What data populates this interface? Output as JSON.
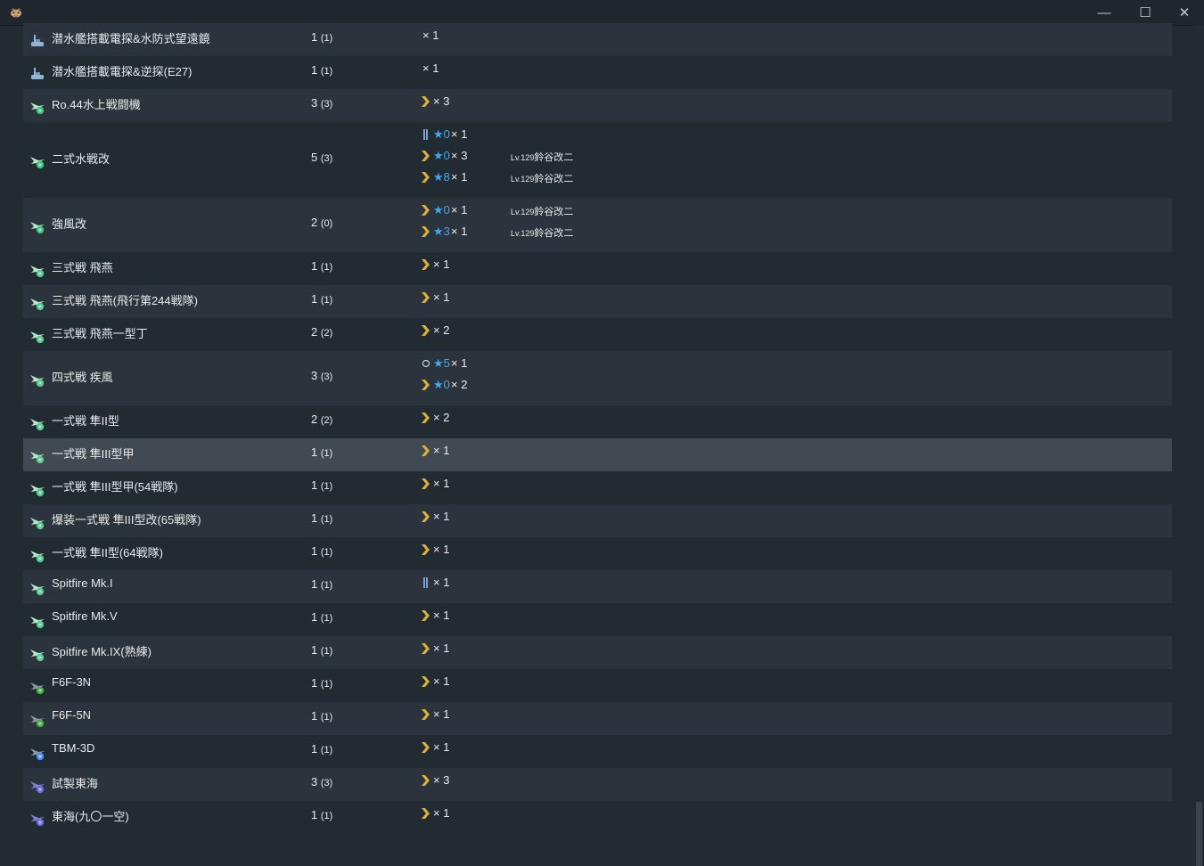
{
  "window": {
    "minimize_glyph": "—",
    "maximize_glyph": "☐",
    "close_glyph": "✕"
  },
  "colors": {
    "prof_chevron": "#d8b23a",
    "prof_bar": "#7f9fd0",
    "prof_circle": "#c9d0d6",
    "star": "#3fa8f4",
    "icon_seaplane": "#3dc080",
    "icon_fighter": "#54c890",
    "icon_nightfighter": "#4aa84a",
    "icon_torpedo": "#4a8ff0",
    "icon_lbaa": "#6a6ae0"
  },
  "rows": [
    {
      "name": "潜水艦搭載電探&水防式望遠鏡",
      "count": "1",
      "count_sub": "(1)",
      "icon": "sub-equipment-icon",
      "details": [
        {
          "prof": "none",
          "mult": "× 1"
        }
      ]
    },
    {
      "name": "潜水艦搭載電探&逆探(E27)",
      "count": "1",
      "count_sub": "(1)",
      "icon": "sub-equipment-icon",
      "details": [
        {
          "prof": "none",
          "mult": "× 1"
        }
      ]
    },
    {
      "name": "Ro.44水上戦闘機",
      "count": "3",
      "count_sub": "(3)",
      "icon": "seaplane-fighter-icon",
      "details": [
        {
          "prof": "chevron",
          "mult": "× 3"
        }
      ]
    },
    {
      "name": "二式水戦改",
      "count": "5",
      "count_sub": "(3)",
      "icon": "seaplane-fighter-icon",
      "details": [
        {
          "prof": "bar",
          "star": "★0",
          "mult": "× 1"
        },
        {
          "prof": "chevron",
          "star": "★0",
          "mult": "× 3",
          "lv_tag": "Lv.129",
          "ship": "鈴谷改二"
        },
        {
          "prof": "chevron",
          "star": "★8",
          "mult": "× 1",
          "lv_tag": "Lv.129",
          "ship": "鈴谷改二"
        }
      ]
    },
    {
      "name": "強風改",
      "count": "2",
      "count_sub": "(0)",
      "icon": "seaplane-fighter-icon",
      "details": [
        {
          "prof": "chevron",
          "star": "★0",
          "mult": "× 1",
          "lv_tag": "Lv.129",
          "ship": "鈴谷改二"
        },
        {
          "prof": "chevron",
          "star": "★3",
          "mult": "× 1",
          "lv_tag": "Lv.129",
          "ship": "鈴谷改二"
        }
      ]
    },
    {
      "name": "三式戦 飛燕",
      "count": "1",
      "count_sub": "(1)",
      "icon": "fighter-icon",
      "details": [
        {
          "prof": "chevron",
          "mult": "× 1"
        }
      ]
    },
    {
      "name": "三式戦 飛燕(飛行第244戦隊)",
      "count": "1",
      "count_sub": "(1)",
      "icon": "fighter-icon",
      "details": [
        {
          "prof": "chevron",
          "mult": "× 1"
        }
      ]
    },
    {
      "name": "三式戦 飛燕一型丁",
      "count": "2",
      "count_sub": "(2)",
      "icon": "fighter-icon",
      "details": [
        {
          "prof": "chevron",
          "mult": "× 2"
        }
      ]
    },
    {
      "name": "四式戦 疾風",
      "count": "3",
      "count_sub": "(3)",
      "icon": "fighter-icon",
      "details": [
        {
          "prof": "circle",
          "star": "★5",
          "mult": "× 1"
        },
        {
          "prof": "chevron",
          "star": "★0",
          "mult": "× 2"
        }
      ]
    },
    {
      "name": "一式戦 隼II型",
      "count": "2",
      "count_sub": "(2)",
      "icon": "fighter-icon",
      "details": [
        {
          "prof": "chevron",
          "mult": "× 2"
        }
      ]
    },
    {
      "name": "一式戦 隼III型甲",
      "count": "1",
      "count_sub": "(1)",
      "icon": "fighter-icon",
      "selected": true,
      "details": [
        {
          "prof": "chevron",
          "mult": "× 1"
        }
      ]
    },
    {
      "name": "一式戦 隼III型甲(54戦隊)",
      "count": "1",
      "count_sub": "(1)",
      "icon": "fighter-icon",
      "details": [
        {
          "prof": "chevron",
          "mult": "× 1"
        }
      ]
    },
    {
      "name": "爆装一式戦 隼III型改(65戦隊)",
      "count": "1",
      "count_sub": "(1)",
      "icon": "fighter-icon",
      "details": [
        {
          "prof": "chevron",
          "mult": "× 1"
        }
      ]
    },
    {
      "name": "一式戦 隼II型(64戦隊)",
      "count": "1",
      "count_sub": "(1)",
      "icon": "fighter-icon",
      "details": [
        {
          "prof": "chevron",
          "mult": "× 1"
        }
      ]
    },
    {
      "name": "Spitfire Mk.I",
      "count": "1",
      "count_sub": "(1)",
      "icon": "fighter-icon",
      "details": [
        {
          "prof": "bar",
          "mult": "× 1"
        }
      ]
    },
    {
      "name": "Spitfire Mk.V",
      "count": "1",
      "count_sub": "(1)",
      "icon": "fighter-icon",
      "details": [
        {
          "prof": "chevron",
          "mult": "× 1"
        }
      ]
    },
    {
      "name": "Spitfire Mk.IX(熟練)",
      "count": "1",
      "count_sub": "(1)",
      "icon": "fighter-icon",
      "details": [
        {
          "prof": "chevron",
          "mult": "× 1"
        }
      ]
    },
    {
      "name": "F6F-3N",
      "count": "1",
      "count_sub": "(1)",
      "icon": "night-fighter-icon",
      "details": [
        {
          "prof": "chevron",
          "mult": "× 1"
        }
      ]
    },
    {
      "name": "F6F-5N",
      "count": "1",
      "count_sub": "(1)",
      "icon": "night-fighter-icon",
      "details": [
        {
          "prof": "chevron",
          "mult": "× 1"
        }
      ]
    },
    {
      "name": "TBM-3D",
      "count": "1",
      "count_sub": "(1)",
      "icon": "torpedo-bomber-icon",
      "details": [
        {
          "prof": "chevron",
          "mult": "× 1"
        }
      ]
    },
    {
      "name": "試製東海",
      "count": "3",
      "count_sub": "(3)",
      "icon": "land-attacker-icon",
      "details": [
        {
          "prof": "chevron",
          "mult": "× 3"
        }
      ]
    },
    {
      "name": "東海(九〇一空)",
      "count": "1",
      "count_sub": "(1)",
      "icon": "land-attacker-icon",
      "details": [
        {
          "prof": "chevron",
          "mult": "× 1"
        }
      ]
    }
  ]
}
